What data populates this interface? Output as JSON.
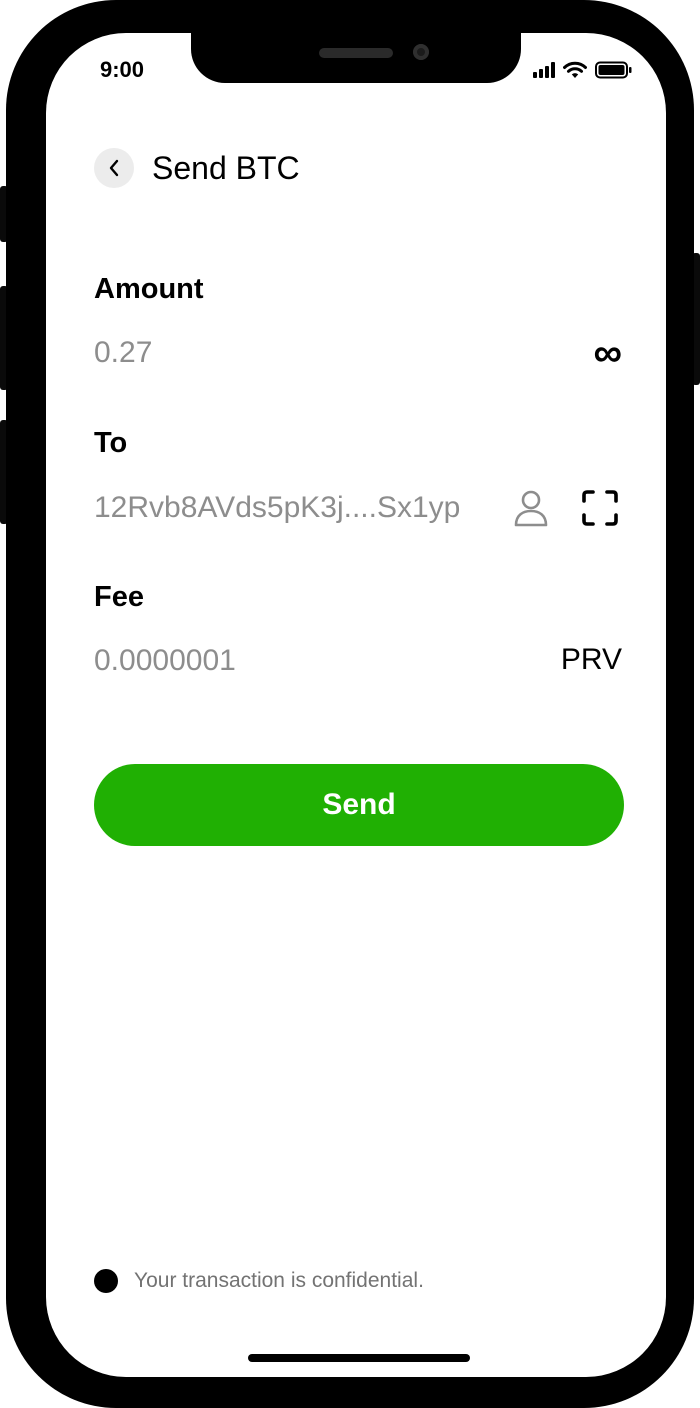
{
  "status_bar": {
    "time": "9:00"
  },
  "header": {
    "title": "Send BTC"
  },
  "amount": {
    "label": "Amount",
    "value": "0.27",
    "max_symbol": "∞"
  },
  "recipient": {
    "label": "To",
    "value": "12Rvb8AVds5pK3j....Sx1yp"
  },
  "fee": {
    "label": "Fee",
    "value": "0.0000001",
    "unit": "PRV"
  },
  "send_button": {
    "label": "Send",
    "color": "#20B003"
  },
  "footer": {
    "note": "Your transaction is confidential."
  },
  "icons": {
    "back": "chevron-left-icon",
    "address_book": "person-icon",
    "scan": "qr-scan-icon",
    "signal": "signal-icon",
    "wifi": "wifi-icon",
    "battery": "battery-icon"
  }
}
